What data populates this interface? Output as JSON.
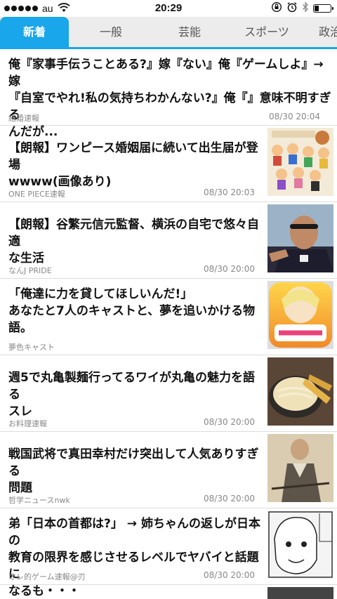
{
  "status": {
    "carrier": "au",
    "time": "20:29",
    "battery_level": 0.25,
    "icons": [
      "signal-dots-icon",
      "wifi-icon",
      "rotation-lock-icon",
      "alarm-icon",
      "bluetooth-icon",
      "battery-icon"
    ]
  },
  "tabs": [
    {
      "label": "新着",
      "active": true
    },
    {
      "label": "一般",
      "active": false
    },
    {
      "label": "芸能",
      "active": false
    },
    {
      "label": "スポーツ",
      "active": false
    },
    {
      "label": "政治",
      "active": false
    }
  ],
  "accent_color": "#1aa6ea",
  "articles": [
    {
      "title_lines": [
        "俺『家事手伝うことある?』嫁『ない』俺『ゲームしよ』→嫁",
        "『自室でやれ!私の気持ちわかんない?』俺『』意味不明すぎる",
        "んだが..."
      ],
      "source": "結婚速報",
      "time": "08/30 20:04",
      "thumbnail": null
    },
    {
      "title_lines": [
        "【朗報】ワンピース婚姻届に続いて出生届が登場",
        "wwww(画像あり)"
      ],
      "source": "ONE PIECE速報",
      "time": "08/30 20:03",
      "thumbnail": "one-piece-birth-certificate-image"
    },
    {
      "title_lines": [
        "【朗報】谷繁元信元監督、横浜の自宅で悠々自適",
        "な生活"
      ],
      "source": "なんJ PRIDE",
      "time": "08/30 20:00",
      "thumbnail": "baseball-manager-photo"
    },
    {
      "title_lines": [
        "「俺達に力を貸してほしいんだ!」",
        "あなたと7人のキャストと、夢を追いかける物",
        "語。"
      ],
      "source": "夢色キャスト",
      "time": "",
      "thumbnail": "yumeiro-cast-app-icon"
    },
    {
      "title_lines": [
        "週5で丸亀製麺行ってるワイが丸亀の魅力を語る",
        "スレ"
      ],
      "source": "お料理速報",
      "time": "08/30 20:00",
      "thumbnail": "udon-photo"
    },
    {
      "title_lines": [
        "戦国武将で真田幸村だけ突出して人気ありすぎる",
        "問題"
      ],
      "source": "哲学ニュースnwk",
      "time": "08/30 20:00",
      "thumbnail": "samurai-portrait"
    },
    {
      "title_lines": [
        "弟「日本の首都は?」 → 姉ちゃんの返しが日本の",
        "教育の限界を感じさせるレベルでヤバイと話題に",
        "なるも・・・"
      ],
      "source": "オレ的ゲーム速報@刃",
      "time": "08/30 20:00",
      "thumbnail": "manga-panel"
    }
  ]
}
